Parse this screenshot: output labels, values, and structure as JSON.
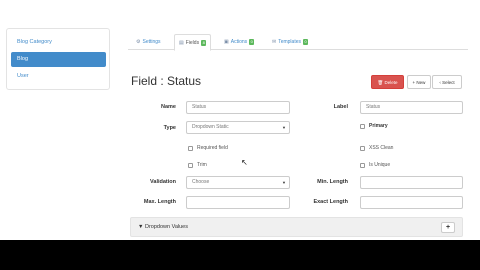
{
  "sidebar": {
    "items": [
      {
        "label": "Blog Category",
        "active": false
      },
      {
        "label": "Blog",
        "active": true
      },
      {
        "label": "User",
        "active": false
      }
    ]
  },
  "tabs": [
    {
      "label": "Settings",
      "icon": "settings-icon",
      "badge": null,
      "active": false
    },
    {
      "label": "Fields",
      "icon": "fields-icon",
      "badge": "8",
      "active": true
    },
    {
      "label": "Actions",
      "icon": "actions-icon",
      "badge": "0",
      "active": false
    },
    {
      "label": "Templates",
      "icon": "templates-icon",
      "badge": "0",
      "active": false
    }
  ],
  "header": {
    "title": "Field : Status",
    "delete_label": "Delete",
    "new_label": "+ New",
    "select_label": "Select"
  },
  "form": {
    "name_label": "Name",
    "name_value": "Status",
    "label_label": "Label",
    "label_value": "Status",
    "type_label": "Type",
    "type_value": "Dropdown Static",
    "primary_label": "Primary",
    "required_label": "Required field",
    "xss_label": "XSS Clean",
    "trim_label": "Trim",
    "unique_label": "Is Unique",
    "validation_label": "Validation",
    "validation_value": "Choose",
    "min_length_label": "Min. Length",
    "max_length_label": "Max. Length",
    "exact_length_label": "Exact Length"
  },
  "panel": {
    "title": "▼ Dropdown Values",
    "add_label": "+"
  },
  "colors": {
    "primary": "#428bca",
    "danger": "#d9534f",
    "badge": "#5cb85c"
  }
}
